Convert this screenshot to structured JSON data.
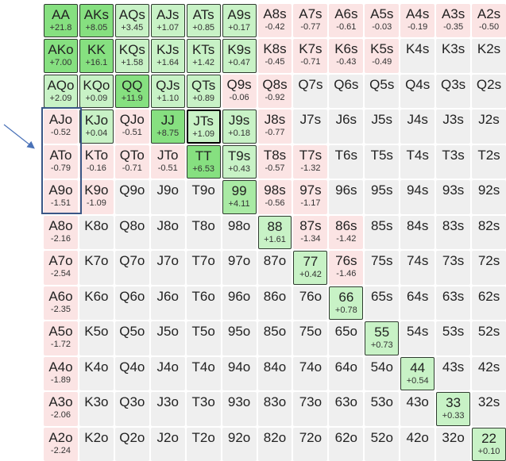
{
  "grid": {
    "rows": [
      [
        [
          "AA",
          "+21.8"
        ],
        [
          "AKs",
          "+8.05"
        ],
        [
          "AQs",
          "+3.45"
        ],
        [
          "AJs",
          "+1.07"
        ],
        [
          "ATs",
          "+0.85"
        ],
        [
          "A9s",
          "+0.17"
        ],
        [
          "A8s",
          "-0.42"
        ],
        [
          "A7s",
          "-0.77"
        ],
        [
          "A6s",
          "-0.61"
        ],
        [
          "A5s",
          "-0.03"
        ],
        [
          "A4s",
          "-0.19"
        ],
        [
          "A3s",
          "-0.35"
        ],
        [
          "A2s",
          "-0.50"
        ]
      ],
      [
        [
          "AKo",
          "+7.00"
        ],
        [
          "KK",
          "+16.1"
        ],
        [
          "KQs",
          "+1.58"
        ],
        [
          "KJs",
          "+1.64"
        ],
        [
          "KTs",
          "+1.42"
        ],
        [
          "K9s",
          "+0.47"
        ],
        [
          "K8s",
          "-0.45"
        ],
        [
          "K7s",
          "-0.71"
        ],
        [
          "K6s",
          "-0.43"
        ],
        [
          "K5s",
          "-0.49"
        ],
        [
          "K4s",
          ""
        ],
        [
          "K3s",
          ""
        ],
        [
          "K2s",
          ""
        ]
      ],
      [
        [
          "AQo",
          "+2.09"
        ],
        [
          "KQo",
          "+0.09"
        ],
        [
          "QQ",
          "+11.9"
        ],
        [
          "QJs",
          "+1.10"
        ],
        [
          "QTs",
          "+0.89"
        ],
        [
          "Q9s",
          "-0.06"
        ],
        [
          "Q8s",
          "-0.92"
        ],
        [
          "Q7s",
          ""
        ],
        [
          "Q6s",
          ""
        ],
        [
          "Q5s",
          ""
        ],
        [
          "Q4s",
          ""
        ],
        [
          "Q3s",
          ""
        ],
        [
          "Q2s",
          ""
        ]
      ],
      [
        [
          "AJo",
          "-0.52"
        ],
        [
          "KJo",
          "+0.04"
        ],
        [
          "QJo",
          "-0.51"
        ],
        [
          "JJ",
          "+8.75"
        ],
        [
          "JTs",
          "+1.09"
        ],
        [
          "J9s",
          "+0.18"
        ],
        [
          "J8s",
          "-0.77"
        ],
        [
          "J7s",
          ""
        ],
        [
          "J6s",
          ""
        ],
        [
          "J5s",
          ""
        ],
        [
          "J4s",
          ""
        ],
        [
          "J3s",
          ""
        ],
        [
          "J2s",
          ""
        ]
      ],
      [
        [
          "ATo",
          "-0.79"
        ],
        [
          "KTo",
          "-0.16"
        ],
        [
          "QTo",
          "-0.71"
        ],
        [
          "JTo",
          "-0.51"
        ],
        [
          "TT",
          "+6.53"
        ],
        [
          "T9s",
          "+0.43"
        ],
        [
          "T8s",
          "-0.57"
        ],
        [
          "T7s",
          "-1.32"
        ],
        [
          "T6s",
          ""
        ],
        [
          "T5s",
          ""
        ],
        [
          "T4s",
          ""
        ],
        [
          "T3s",
          ""
        ],
        [
          "T2s",
          ""
        ]
      ],
      [
        [
          "A9o",
          "-1.51"
        ],
        [
          "K9o",
          "-1.09"
        ],
        [
          "Q9o",
          ""
        ],
        [
          "J9o",
          ""
        ],
        [
          "T9o",
          ""
        ],
        [
          "99",
          "+4.11"
        ],
        [
          "98s",
          "-0.56"
        ],
        [
          "97s",
          "-1.17"
        ],
        [
          "96s",
          ""
        ],
        [
          "95s",
          ""
        ],
        [
          "94s",
          ""
        ],
        [
          "93s",
          ""
        ],
        [
          "92s",
          ""
        ]
      ],
      [
        [
          "A8o",
          "-2.16"
        ],
        [
          "K8o",
          ""
        ],
        [
          "Q8o",
          ""
        ],
        [
          "J8o",
          ""
        ],
        [
          "T8o",
          ""
        ],
        [
          "98o",
          ""
        ],
        [
          "88",
          "+1.61"
        ],
        [
          "87s",
          "-1.34"
        ],
        [
          "86s",
          "-1.42"
        ],
        [
          "85s",
          ""
        ],
        [
          "84s",
          ""
        ],
        [
          "83s",
          ""
        ],
        [
          "82s",
          ""
        ]
      ],
      [
        [
          "A7o",
          "-2.54"
        ],
        [
          "K7o",
          ""
        ],
        [
          "Q7o",
          ""
        ],
        [
          "J7o",
          ""
        ],
        [
          "T7o",
          ""
        ],
        [
          "97o",
          ""
        ],
        [
          "87o",
          ""
        ],
        [
          "77",
          "+0.42"
        ],
        [
          "76s",
          "-1.46"
        ],
        [
          "75s",
          ""
        ],
        [
          "74s",
          ""
        ],
        [
          "73s",
          ""
        ],
        [
          "72s",
          ""
        ]
      ],
      [
        [
          "A6o",
          "-2.35"
        ],
        [
          "K6o",
          ""
        ],
        [
          "Q6o",
          ""
        ],
        [
          "J6o",
          ""
        ],
        [
          "T6o",
          ""
        ],
        [
          "96o",
          ""
        ],
        [
          "86o",
          ""
        ],
        [
          "76o",
          ""
        ],
        [
          "66",
          "+0.78"
        ],
        [
          "65s",
          ""
        ],
        [
          "64s",
          ""
        ],
        [
          "63s",
          ""
        ],
        [
          "62s",
          ""
        ]
      ],
      [
        [
          "A5o",
          "-1.72"
        ],
        [
          "K5o",
          ""
        ],
        [
          "Q5o",
          ""
        ],
        [
          "J5o",
          ""
        ],
        [
          "T5o",
          ""
        ],
        [
          "95o",
          ""
        ],
        [
          "85o",
          ""
        ],
        [
          "75o",
          ""
        ],
        [
          "65o",
          ""
        ],
        [
          "55",
          "+0.73"
        ],
        [
          "54s",
          ""
        ],
        [
          "53s",
          ""
        ],
        [
          "52s",
          ""
        ]
      ],
      [
        [
          "A4o",
          "-1.89"
        ],
        [
          "K4o",
          ""
        ],
        [
          "Q4o",
          ""
        ],
        [
          "J4o",
          ""
        ],
        [
          "T4o",
          ""
        ],
        [
          "94o",
          ""
        ],
        [
          "84o",
          ""
        ],
        [
          "74o",
          ""
        ],
        [
          "64o",
          ""
        ],
        [
          "54o",
          ""
        ],
        [
          "44",
          "+0.54"
        ],
        [
          "43s",
          ""
        ],
        [
          "42s",
          ""
        ]
      ],
      [
        [
          "A3o",
          "-2.06"
        ],
        [
          "K3o",
          ""
        ],
        [
          "Q3o",
          ""
        ],
        [
          "J3o",
          ""
        ],
        [
          "T3o",
          ""
        ],
        [
          "93o",
          ""
        ],
        [
          "83o",
          ""
        ],
        [
          "73o",
          ""
        ],
        [
          "63o",
          ""
        ],
        [
          "53o",
          ""
        ],
        [
          "43o",
          ""
        ],
        [
          "33",
          "+0.33"
        ],
        [
          "32s",
          ""
        ]
      ],
      [
        [
          "A2o",
          "-2.24"
        ],
        [
          "K2o",
          ""
        ],
        [
          "Q2o",
          ""
        ],
        [
          "J2o",
          ""
        ],
        [
          "T2o",
          ""
        ],
        [
          "92o",
          ""
        ],
        [
          "82o",
          ""
        ],
        [
          "72o",
          ""
        ],
        [
          "62o",
          ""
        ],
        [
          "52o",
          ""
        ],
        [
          "42o",
          ""
        ],
        [
          "32o",
          ""
        ],
        [
          "22",
          "+0.10"
        ]
      ]
    ],
    "selected_hand": "JTs",
    "highlighted_hands": [
      "AJo",
      "ATo",
      "A9o"
    ],
    "colors": {
      "positive": "#c8f2c6",
      "strong_positive": "#86e080",
      "negative": "#fbe4e4",
      "neutral": "#efefef",
      "highlight": "#3b5786"
    }
  }
}
